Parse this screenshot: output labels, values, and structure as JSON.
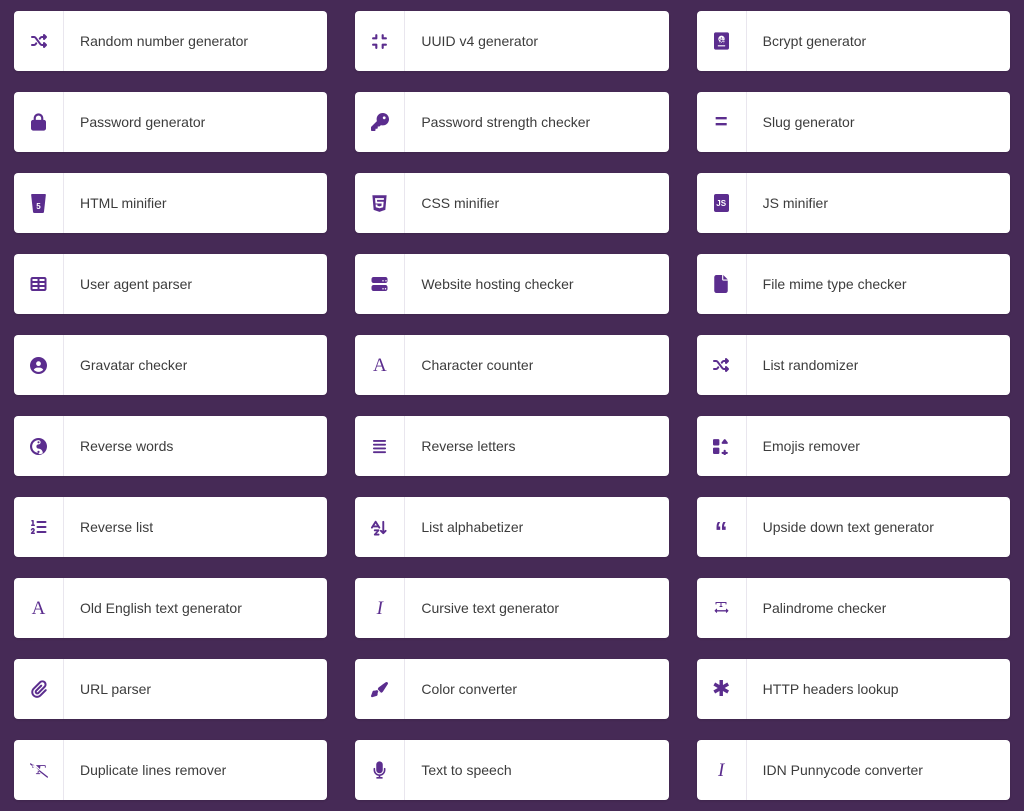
{
  "theme": {
    "background": "#462A56",
    "card_background": "#ffffff",
    "icon_color": "#5B2D8E",
    "label_color": "#3c3c3c",
    "divider_color": "#e9e6ee"
  },
  "tools": [
    {
      "label": "Random number generator",
      "icon": "shuffle-icon"
    },
    {
      "label": "UUID v4 generator",
      "icon": "compress-arrows-icon"
    },
    {
      "label": "Bcrypt generator",
      "icon": "passport-icon"
    },
    {
      "label": "Password generator",
      "icon": "lock-icon"
    },
    {
      "label": "Password strength checker",
      "icon": "key-icon"
    },
    {
      "label": "Slug generator",
      "icon": "equals-icon"
    },
    {
      "label": "HTML minifier",
      "icon": "html5-icon"
    },
    {
      "label": "CSS minifier",
      "icon": "css3-icon"
    },
    {
      "label": "JS minifier",
      "icon": "js-icon"
    },
    {
      "label": "User agent parser",
      "icon": "columns-icon"
    },
    {
      "label": "Website hosting checker",
      "icon": "server-icon"
    },
    {
      "label": "File mime type checker",
      "icon": "file-icon"
    },
    {
      "label": "Gravatar checker",
      "icon": "user-circle-icon"
    },
    {
      "label": "Character counter",
      "icon": "letter-a-icon"
    },
    {
      "label": "List randomizer",
      "icon": "shuffle-icon"
    },
    {
      "label": "Reverse words",
      "icon": "yin-yang-icon"
    },
    {
      "label": "Reverse letters",
      "icon": "align-right-icon"
    },
    {
      "label": "Emojis remover",
      "icon": "icons-grid-icon"
    },
    {
      "label": "Reverse list",
      "icon": "ordered-list-icon"
    },
    {
      "label": "List alphabetizer",
      "icon": "sort-alpha-up-icon"
    },
    {
      "label": "Upside down text generator",
      "icon": "quote-left-icon"
    },
    {
      "label": "Old English text generator",
      "icon": "letter-a-icon"
    },
    {
      "label": "Cursive text generator",
      "icon": "italic-icon"
    },
    {
      "label": "Palindrome checker",
      "icon": "text-width-icon"
    },
    {
      "label": "URL parser",
      "icon": "paperclip-icon"
    },
    {
      "label": "Color converter",
      "icon": "paint-brush-icon"
    },
    {
      "label": "HTTP headers lookup",
      "icon": "asterisk-icon"
    },
    {
      "label": "Duplicate lines remover",
      "icon": "remove-format-icon"
    },
    {
      "label": "Text to speech",
      "icon": "microphone-icon"
    },
    {
      "label": "IDN Punnycode converter",
      "icon": "italic-icon"
    }
  ]
}
